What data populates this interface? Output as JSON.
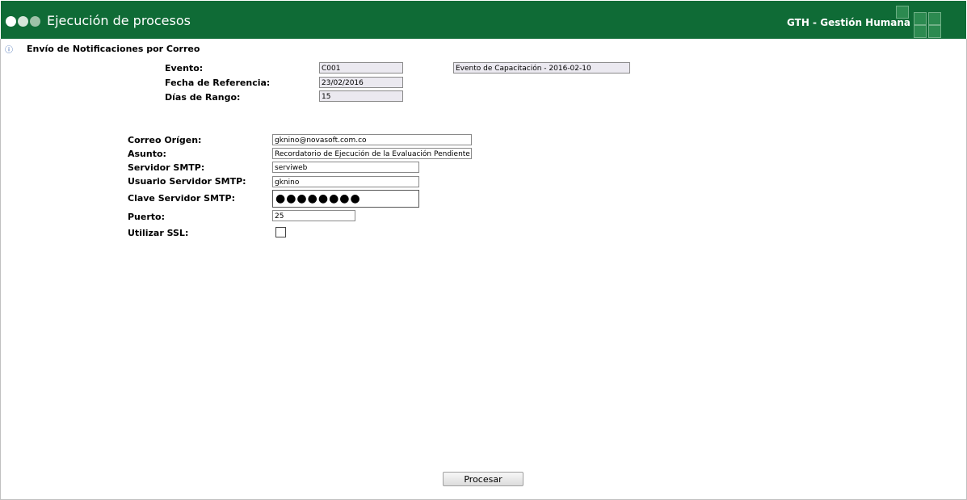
{
  "header": {
    "title": "Ejecución de procesos",
    "app_name": "GTH - Gestión Humana"
  },
  "section_title": "Envío de Notificaciones por Correo",
  "evento": {
    "label": "Evento:",
    "code": "C001",
    "description": "Evento de Capacitación - 2016-02-10"
  },
  "fecha_referencia": {
    "label": "Fecha de Referencia:",
    "value": "23/02/2016"
  },
  "dias_rango": {
    "label": "Días de Rango:",
    "value": "15"
  },
  "correo_origen": {
    "label": "Correo Orígen:",
    "value": "gknino@novasoft.com.co"
  },
  "asunto": {
    "label": "Asunto:",
    "value": "Recordatorio de Ejecución de la Evaluación Pendiente"
  },
  "servidor_smtp": {
    "label": "Servidor SMTP:",
    "value": "serviweb"
  },
  "usuario_smtp": {
    "label": "Usuario Servidor SMTP:",
    "value": "gknino"
  },
  "clave_smtp": {
    "label": "Clave Servidor SMTP:",
    "value": "●●●●●●●●"
  },
  "puerto": {
    "label": "Puerto:",
    "value": "25"
  },
  "ssl": {
    "label": "Utilizar SSL:",
    "checked": false
  },
  "process_button": "Procesar",
  "colors": {
    "header_bg": "#0f6b36",
    "readonly_bg": "#ebe9f0"
  }
}
